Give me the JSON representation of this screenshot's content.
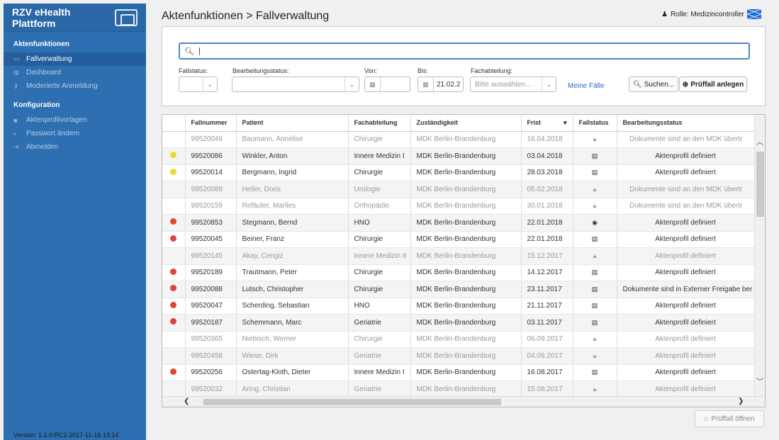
{
  "brand": {
    "title": "RZV eHealth Plattform"
  },
  "sidebar": {
    "section1": "Aktenfunktionen",
    "items1": [
      {
        "label": "Fallverwaltung",
        "icon": "folder-icon"
      },
      {
        "label": "Dashboard",
        "icon": "dashboard-icon"
      },
      {
        "label": "Moderierte Anmeldung",
        "icon": "key-icon"
      }
    ],
    "section2": "Konfiguration",
    "items2": [
      {
        "label": "Aktenprofilvorlagen",
        "icon": "briefcase-icon"
      },
      {
        "label": "Passwort ändern",
        "icon": "lock-icon"
      },
      {
        "label": "Abmelden",
        "icon": "logout-icon"
      }
    ],
    "version": "Version: 1.1.0.RC3 2017-11-16 13:14"
  },
  "header": {
    "title": "Aktenfunktionen > Fallverwaltung",
    "role": "Rolle: Medizincontroller"
  },
  "filters": {
    "search_value": "|",
    "fallstatus_label": "Fallstatus:",
    "bearbeitung_label": "Bearbeitungsstatus:",
    "von_label": "Von:",
    "bis_label": "Bis:",
    "bis_value": "21.02.2",
    "fach_label": "Fachabteilung:",
    "fach_placeholder": "Bitte auswählen...",
    "meine_faelle": "Meine Fälle",
    "search_button": "Suchen...",
    "create_button": "Prüffall anlegen"
  },
  "table": {
    "columns": [
      "Fallnummer",
      "Patient",
      "Fachabteilung",
      "Zuständigkeit",
      "Frist",
      "Fallstatus",
      "Bearbeitungsstatus"
    ],
    "rows": [
      {
        "dot": "",
        "nr": "99520049",
        "patient": "Baumann, Annelise",
        "fach": "Chirurgie",
        "zust": "MDK Berlin-Brandenburg",
        "frist": "16.04.2018",
        "status_icon": "lock",
        "bearb": "Dokumente sind an den MDK übertr",
        "muted": true
      },
      {
        "dot": "#f0d92a",
        "nr": "99520086",
        "patient": "Winkler, Anton",
        "fach": "Innere Medizin I",
        "zust": "MDK Berlin-Brandenburg",
        "frist": "03.04.2018",
        "status_icon": "doc",
        "bearb": "Aktenprofil definiert",
        "muted": false
      },
      {
        "dot": "#f0d92a",
        "nr": "99520014",
        "patient": "Bergmann, Ingrid",
        "fach": "Chirurgie",
        "zust": "MDK Berlin-Brandenburg",
        "frist": "28.03.2018",
        "status_icon": "doc",
        "bearb": "Aktenprofil definiert",
        "muted": false
      },
      {
        "dot": "",
        "nr": "99520089",
        "patient": "Heller, Doris",
        "fach": "Urologie",
        "zust": "MDK Berlin-Brandenburg",
        "frist": "05.02.2018",
        "status_icon": "lock",
        "bearb": "Dokumente sind an den MDK übertr",
        "muted": true
      },
      {
        "dot": "",
        "nr": "99520159",
        "patient": "Refäuter, Marlies",
        "fach": "Orthopädie",
        "zust": "MDK Berlin-Brandenburg",
        "frist": "30.01.2018",
        "status_icon": "lock",
        "bearb": "Dokumente sind an den MDK übertr",
        "muted": true
      },
      {
        "dot": "#e0443a",
        "nr": "99520853",
        "patient": "Stegmann, Bernd",
        "fach": "HNO",
        "zust": "MDK Berlin-Brandenburg",
        "frist": "22.01.2018",
        "status_icon": "eye",
        "bearb": "Aktenprofil definiert",
        "muted": false
      },
      {
        "dot": "#e0443a",
        "nr": "99520045",
        "patient": "Beiner, Franz",
        "fach": "Chirurgie",
        "zust": "MDK Berlin-Brandenburg",
        "frist": "22.01.2018",
        "status_icon": "doc",
        "bearb": "Aktenprofil definiert",
        "muted": false
      },
      {
        "dot": "",
        "nr": "99520145",
        "patient": "Akay, Cengiz",
        "fach": "Innere Medizin II",
        "zust": "MDK Berlin-Brandenburg",
        "frist": "15.12.2017",
        "status_icon": "lock",
        "bearb": "Aktenprofil definiert",
        "muted": true
      },
      {
        "dot": "#e0443a",
        "nr": "99520189",
        "patient": "Trautmann, Peter",
        "fach": "Chirurgie",
        "zust": "MDK Berlin-Brandenburg",
        "frist": "14.12.2017",
        "status_icon": "doc",
        "bearb": "Aktenprofil definiert",
        "muted": false
      },
      {
        "dot": "#e0443a",
        "nr": "99520088",
        "patient": "Lutsch, Christopher",
        "fach": "Chirurgie",
        "zust": "MDK Berlin-Brandenburg",
        "frist": "23.11.2017",
        "status_icon": "doc",
        "bearb": "Dokumente sind in Externer Freigabe ber",
        "muted": false
      },
      {
        "dot": "#e0443a",
        "nr": "99520047",
        "patient": "Scherding, Sebastian",
        "fach": "HNO",
        "zust": "MDK Berlin-Brandenburg",
        "frist": "21.11.2017",
        "status_icon": "doc",
        "bearb": "Aktenprofil definiert",
        "muted": false
      },
      {
        "dot": "#e0443a",
        "nr": "99520187",
        "patient": "Schemmann, Marc",
        "fach": "Geriatrie",
        "zust": "MDK Berlin-Brandenburg",
        "frist": "03.11.2017",
        "status_icon": "doc",
        "bearb": "Aktenprofil definiert",
        "muted": false
      },
      {
        "dot": "",
        "nr": "99520365",
        "patient": "Niebisch, Werner",
        "fach": "Chirurgie",
        "zust": "MDK Berlin-Brandenburg",
        "frist": "06.09.2017",
        "status_icon": "lock",
        "bearb": "Aktenprofil definiert",
        "muted": true
      },
      {
        "dot": "",
        "nr": "99520458",
        "patient": "Wiese, Dirk",
        "fach": "Geriatrie",
        "zust": "MDK Berlin-Brandenburg",
        "frist": "04.09.2017",
        "status_icon": "lock",
        "bearb": "Aktenprofil definiert",
        "muted": true
      },
      {
        "dot": "#e0443a",
        "nr": "99520256",
        "patient": "Ostertag-Kloth, Dieter",
        "fach": "Innere Medizin I",
        "zust": "MDK Berlin-Brandenburg",
        "frist": "16.08.2017",
        "status_icon": "doc",
        "bearb": "Aktenprofil definiert",
        "muted": false
      },
      {
        "dot": "",
        "nr": "99520032",
        "patient": "Aring, Christian",
        "fach": "Geriatrie",
        "zust": "MDK Berlin-Brandenburg",
        "frist": "15.08.2017",
        "status_icon": "lock",
        "bearb": "Aktenprofil definiert",
        "muted": true
      }
    ]
  },
  "footer": {
    "open_button": "Prüffall öffnen"
  }
}
